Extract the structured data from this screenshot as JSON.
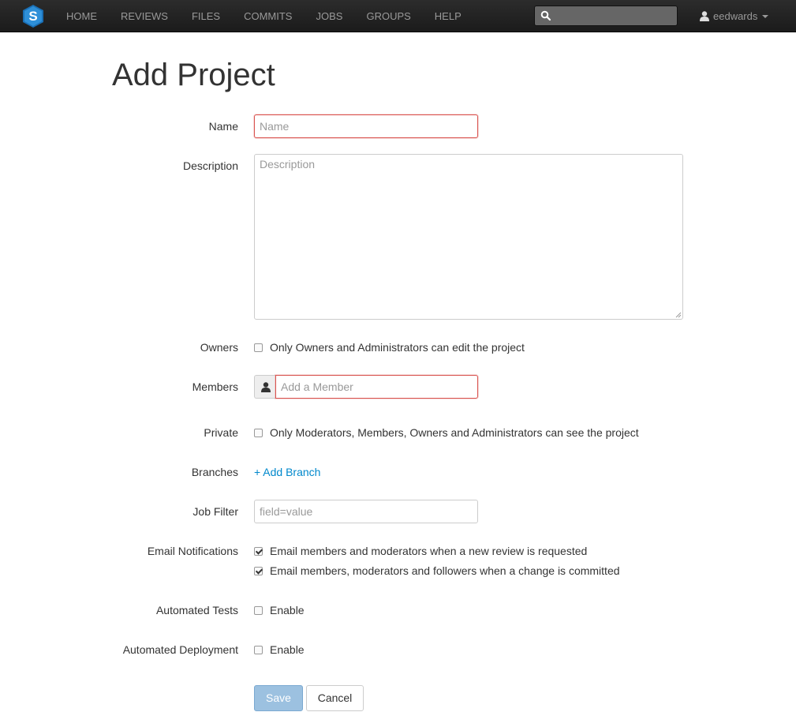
{
  "navbar": {
    "logo_letter": "S",
    "items": [
      {
        "label": "HOME"
      },
      {
        "label": "REVIEWS"
      },
      {
        "label": "FILES"
      },
      {
        "label": "COMMITS"
      },
      {
        "label": "JOBS"
      },
      {
        "label": "GROUPS"
      },
      {
        "label": "HELP"
      }
    ],
    "search": {
      "placeholder": "",
      "value": ""
    },
    "user": {
      "name": "eedwards"
    }
  },
  "page": {
    "title": "Add Project"
  },
  "form": {
    "name": {
      "label": "Name",
      "placeholder": "Name"
    },
    "description": {
      "label": "Description",
      "placeholder": "Description"
    },
    "owners": {
      "label": "Owners",
      "checkbox_label": "Only Owners and Administrators can edit the project",
      "checked": false
    },
    "members": {
      "label": "Members",
      "placeholder": "Add a Member"
    },
    "private": {
      "label": "Private",
      "checkbox_label": "Only Moderators, Members, Owners and Administrators can see the project",
      "checked": false
    },
    "branches": {
      "label": "Branches",
      "add_link": "+ Add Branch"
    },
    "job_filter": {
      "label": "Job Filter",
      "placeholder": "field=value"
    },
    "email_notifications": {
      "label": "Email Notifications",
      "options": [
        {
          "label": "Email members and moderators when a new review is requested",
          "checked": true
        },
        {
          "label": "Email members, moderators and followers when a change is committed",
          "checked": true
        }
      ]
    },
    "automated_tests": {
      "label": "Automated Tests",
      "checkbox_label": "Enable",
      "checked": false
    },
    "automated_deployment": {
      "label": "Automated Deployment",
      "checkbox_label": "Enable",
      "checked": false
    },
    "buttons": {
      "save": "Save",
      "cancel": "Cancel"
    }
  },
  "colors": {
    "navbar_bg": "#1b1b1b",
    "logo_bg": "#1a6fb5",
    "link": "#0088cc",
    "error_border": "#d9534f",
    "save_button_bg": "#9cc1e0"
  }
}
